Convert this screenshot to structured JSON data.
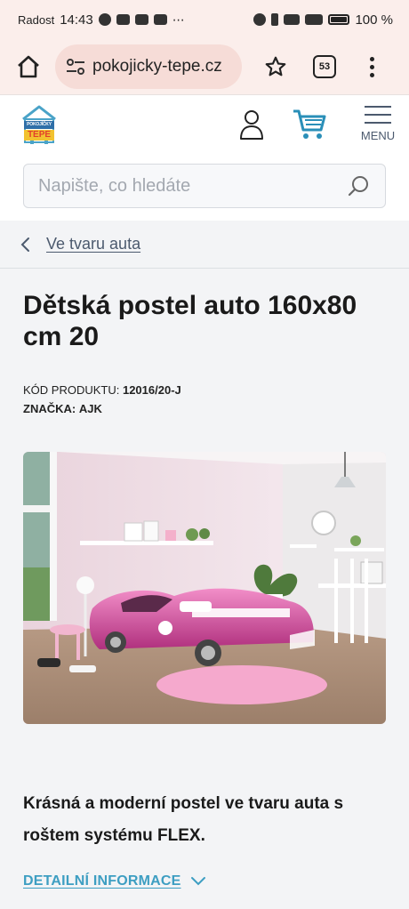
{
  "status_bar": {
    "carrier": "Radost",
    "time": "14:43",
    "extra": "⋯",
    "battery": "100 %"
  },
  "browser": {
    "url": "pokojicky-tepe.cz",
    "tab_count": "53"
  },
  "site": {
    "logo_text_top": "POKOJÍČKY",
    "logo_text_bottom": "TEPE",
    "menu_label": "MENU"
  },
  "search": {
    "placeholder": "Napište, co hledáte"
  },
  "breadcrumb": {
    "label": "Ve tvaru auta"
  },
  "product": {
    "title": "Dětská postel auto 160x80 cm 20",
    "code_label": "KÓD PRODUKTU:",
    "code_value": "12016/20-J",
    "brand_label": "ZNAČKA:",
    "brand_value": "AJK",
    "description": "Krásná a moderní postel ve tvaru auta s roštem systému FLEX.",
    "details_link": "DETAILNÍ INFORMACE"
  },
  "colors": {
    "accent_link": "#3d9ec2",
    "nav_gray": "#4c5a6e",
    "browser_bg": "#fbeeeb"
  }
}
